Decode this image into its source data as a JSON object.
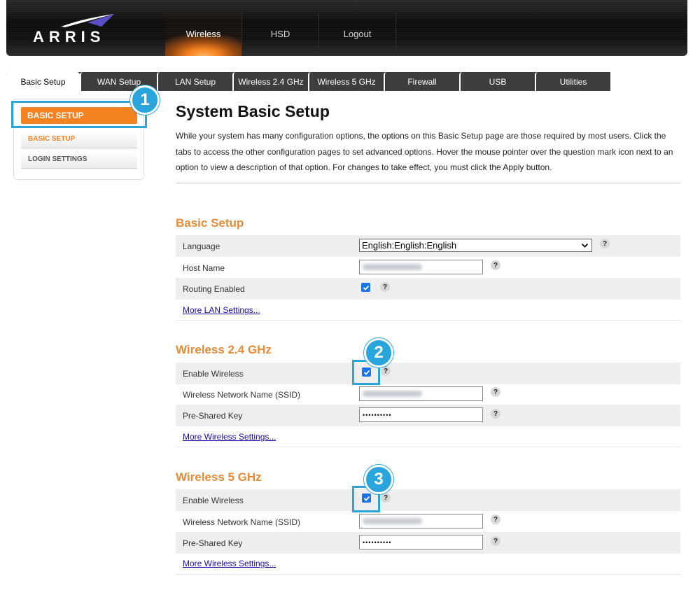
{
  "brand": {
    "logo_text": "ARRIS"
  },
  "main_nav": [
    {
      "label": "Wireless",
      "active": true
    },
    {
      "label": "HSD",
      "active": false
    },
    {
      "label": "Logout",
      "active": false
    }
  ],
  "subtabs": [
    {
      "label": "Basic Setup",
      "active": true
    },
    {
      "label": "WAN Setup"
    },
    {
      "label": "LAN Setup"
    },
    {
      "label": "Wireless 2.4 GHz"
    },
    {
      "label": "Wireless 5 GHz"
    },
    {
      "label": "Firewall"
    },
    {
      "label": "USB"
    },
    {
      "label": "Utilities"
    }
  ],
  "sidemenu": {
    "primary": "BASIC SETUP",
    "items": [
      "BASIC SETUP",
      "LOGIN SETTINGS"
    ]
  },
  "page": {
    "title": "System Basic Setup",
    "intro": "While your system has many configuration options, the options on this Basic Setup page are those required by most users. Click the tabs to access the other configuration pages to set advanced options. Hover the mouse pointer over the question mark icon next to an option to view a description of that option. For changes to take effect, you must click the Apply button."
  },
  "basic_setup": {
    "title": "Basic Setup",
    "language_label": "Language",
    "language_value": "English:English:English",
    "host_name_label": "Host Name",
    "routing_label": "Routing Enabled",
    "routing_checked": true,
    "more_link": "More LAN Settings..."
  },
  "wireless24": {
    "title": "Wireless 2.4 GHz",
    "enable_label": "Enable Wireless",
    "enable_checked": true,
    "ssid_label": "Wireless Network Name (SSID)",
    "psk_label": "Pre-Shared Key",
    "psk_value": "••••••••••",
    "more_link": "More Wireless Settings..."
  },
  "wireless5": {
    "title": "Wireless 5 GHz",
    "enable_label": "Enable Wireless",
    "enable_checked": true,
    "ssid_label": "Wireless Network Name (SSID)",
    "psk_label": "Pre-Shared Key",
    "psk_value": "••••••••••",
    "more_link": "More Wireless Settings..."
  },
  "help_glyph": "?",
  "callouts": [
    "1",
    "2",
    "3"
  ],
  "colors": {
    "accent_orange": "#f58220",
    "section_orange": "#e98a34",
    "callout_blue": "#29a5dc",
    "checkbox_blue": "#1a73e8"
  }
}
